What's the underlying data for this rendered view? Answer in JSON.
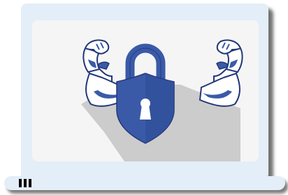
{
  "illustration": {
    "subject": "strong-security-lock",
    "icons": [
      "flexing-arm-left-icon",
      "padlock-icon",
      "shield-icon",
      "keyhole-icon",
      "flexing-arm-right-icon"
    ]
  },
  "colors": {
    "device_frame": "#e3eef8",
    "screen_background": "#f5f5f5",
    "lock_blue": "#3a5aa8",
    "lock_blue_dark": "#22377a",
    "lock_shadow": "#cccccc",
    "vents": "#000000"
  }
}
